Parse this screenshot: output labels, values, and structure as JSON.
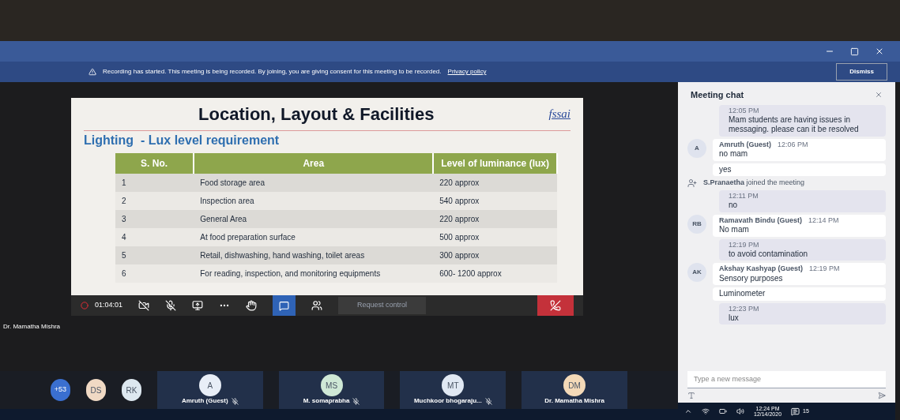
{
  "banner": {
    "message": "Recording has started. This meeting is being recorded. By joining, you are giving consent for this meeting to be recorded.",
    "link": "Privacy policy",
    "button": "Dismiss"
  },
  "slide": {
    "title": "Location, Layout & Facilities",
    "logo": "fssai",
    "subtitle": "Lighting  - Lux level requirement",
    "columns": [
      "S. No.",
      "Area",
      "Level of luminance (lux)"
    ],
    "rows": [
      [
        "1",
        "Food storage area",
        "220 approx"
      ],
      [
        "2",
        "Inspection area",
        "540 approx"
      ],
      [
        "3",
        "General Area",
        "220 approx"
      ],
      [
        "4",
        "At food preparation surface",
        "500 approx"
      ],
      [
        "5",
        "Retail, dishwashing, hand washing, toilet areas",
        "300 approx"
      ],
      [
        "6",
        "For reading, inspection, and monitoring equipments",
        "600- 1200 approx"
      ]
    ]
  },
  "toolbar": {
    "timer": "01:04:01",
    "chat_selected": true,
    "request_control": "Request control"
  },
  "presenter": "Dr. Mamatha Mishra",
  "participants": {
    "overflow": "+53",
    "avatars": [
      {
        "initials": "DS",
        "color": "#f0d9c4"
      },
      {
        "initials": "RK",
        "color": "#dde8f0"
      }
    ],
    "tiles": [
      {
        "initials": "A",
        "name": "Amruth (Guest)",
        "muted": true,
        "color": "#e8eef7"
      },
      {
        "initials": "MS",
        "name": "M. somaprabha",
        "muted": true,
        "color": "#cfe8d6"
      },
      {
        "initials": "MT",
        "name": "Muchkoor bhogaraju...",
        "muted": true,
        "color": "#e0e8f3"
      },
      {
        "initials": "DM",
        "name": "Dr. Mamatha Mishra",
        "muted": false,
        "color": "#f3d9b8"
      }
    ]
  },
  "chat": {
    "title": "Meeting chat",
    "placeholder": "Type a new message",
    "messages": [
      {
        "kind": "own",
        "time": "12:05 PM",
        "text": "Mam students are having issues in messaging. please can it be resolved"
      },
      {
        "kind": "other",
        "initials": "A",
        "author": "Amruth (Guest)",
        "time": "12:06 PM",
        "text": "no mam"
      },
      {
        "kind": "plain",
        "text": "yes"
      },
      {
        "kind": "event",
        "author": "S.Pranaetha",
        "text": "joined the meeting"
      },
      {
        "kind": "own",
        "time": "12:11 PM",
        "text": "no"
      },
      {
        "kind": "other",
        "initials": "RB",
        "author": "Ramavath Bindu (Guest)",
        "time": "12:14 PM",
        "text": "No mam"
      },
      {
        "kind": "own",
        "time": "12:19 PM",
        "text": "to avoid contamination"
      },
      {
        "kind": "other",
        "initials": "AK",
        "author": "Akshay Kashyap (Guest)",
        "time": "12:19 PM",
        "text": "Sensory purposes"
      },
      {
        "kind": "plain",
        "text": "Luminometer"
      },
      {
        "kind": "own",
        "time": "12:23 PM",
        "text": "lux"
      }
    ]
  },
  "taskbar": {
    "time": "12:24 PM",
    "date": "12/14/2020",
    "notifications": "15"
  }
}
